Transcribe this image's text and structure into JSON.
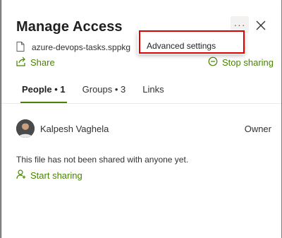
{
  "panel": {
    "title": "Manage Access",
    "more_label": "···",
    "file": {
      "name": "azure-devops-tasks.sppkg"
    },
    "share_label": "Share",
    "stop_sharing_label": "Stop sharing"
  },
  "tabs": [
    {
      "label": "People • 1",
      "active": true
    },
    {
      "label": "Groups • 3",
      "active": false
    },
    {
      "label": "Links",
      "active": false
    }
  ],
  "people": [
    {
      "name": "Kalpesh Vaghela",
      "role": "Owner"
    }
  ],
  "empty_message": "This file has not been shared with anyone yet.",
  "start_sharing_label": "Start sharing",
  "menu": {
    "items": [
      {
        "label": "Advanced settings"
      }
    ]
  },
  "colors": {
    "accent": "#498205",
    "highlight": "#e00000"
  }
}
